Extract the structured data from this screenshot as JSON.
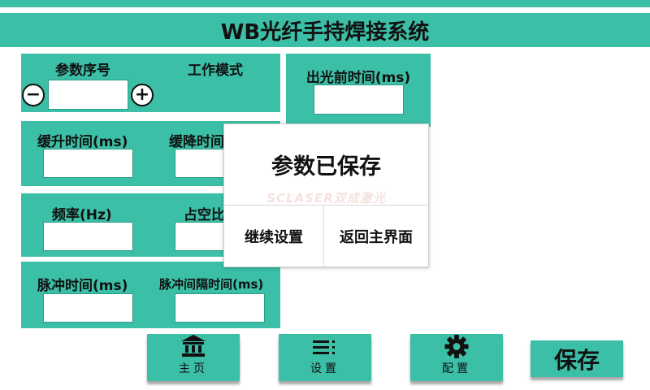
{
  "header": {
    "title": "WB光纤手持焊接系统"
  },
  "panel1": {
    "param_label": "参数序号",
    "mode_label": "工作模式",
    "minus": "−",
    "plus": "+",
    "param_value": ""
  },
  "panel_pre": {
    "label": "出光前时间(ms)",
    "value": ""
  },
  "panel2": {
    "ramp_up_label": "缓升时间(ms)",
    "ramp_down_label": "缓降时间",
    "ramp_up_value": "",
    "ramp_down_value": ""
  },
  "panel3": {
    "freq_label": "频率(Hz)",
    "duty_label": "占空比",
    "freq_value": "",
    "duty_value": ""
  },
  "panel4": {
    "pulse_label": "脉冲时间(ms)",
    "interval_label": "脉冲间隔时间(ms)",
    "pulse_value": "",
    "interval_value": ""
  },
  "modal": {
    "title": "参数已保存",
    "watermark": "SCLASER双成激光",
    "continue_label": "继续设置",
    "back_label": "返回主界面"
  },
  "nav": {
    "home_label": "主页",
    "settings_label": "设置",
    "config_label": "配置",
    "save_label": "保存"
  },
  "icons": {
    "home": "bank-icon",
    "settings": "menu-icon",
    "config": "gear-icon"
  },
  "colors": {
    "accent": "#3bbfa6",
    "background": "#ffffff"
  }
}
